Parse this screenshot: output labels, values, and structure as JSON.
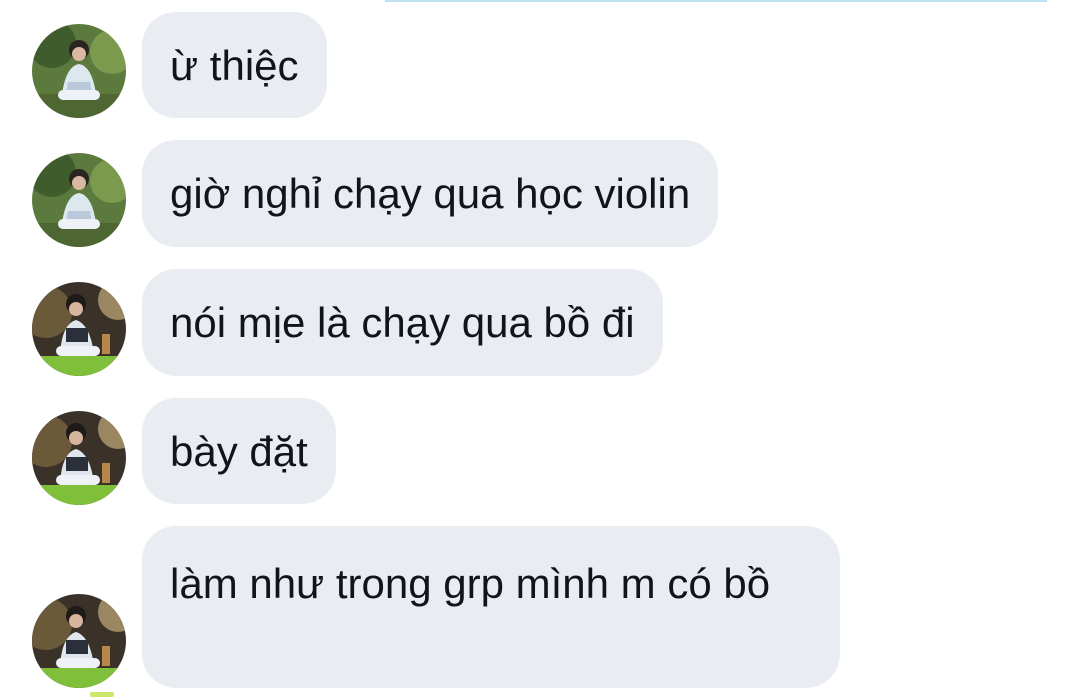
{
  "messages": [
    {
      "text": "ừ thiệc",
      "avatar": "avatar-green-photo"
    },
    {
      "text": "giờ nghỉ chạy qua học violin",
      "avatar": "avatar-green-photo"
    },
    {
      "text": "nói mịe là chạy qua bồ đi",
      "avatar": "avatar-dark-photo"
    },
    {
      "text": "bày đặt",
      "avatar": "avatar-dark-photo"
    },
    {
      "text": "làm như trong grp mình m có bồ",
      "avatar": "avatar-dark-photo"
    }
  ],
  "colors": {
    "bubble_bg": "#e9edf2",
    "text": "#111418",
    "top_divider": "#bfe3f3"
  }
}
